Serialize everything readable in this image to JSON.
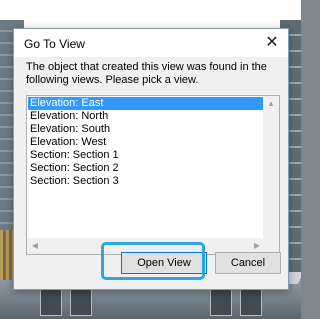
{
  "dialog": {
    "title": "Go To View",
    "close_glyph": "✕",
    "message": "The object that created this view was found in the following views.  Please pick a view.",
    "views": [
      "Elevation: East",
      "Elevation: North",
      "Elevation: South",
      "Elevation: West",
      "Section: Section 1",
      "Section: Section 2",
      "Section: Section 3"
    ],
    "selected_view": "Elevation: East",
    "scroll_up": "▲",
    "scroll_down": "▼",
    "scroll_left": "◀",
    "scroll_right": "▶",
    "open_label": "Open View",
    "cancel_label": "Cancel"
  },
  "colors": {
    "selection": "#3399ff",
    "highlight": "#2aa7de"
  }
}
